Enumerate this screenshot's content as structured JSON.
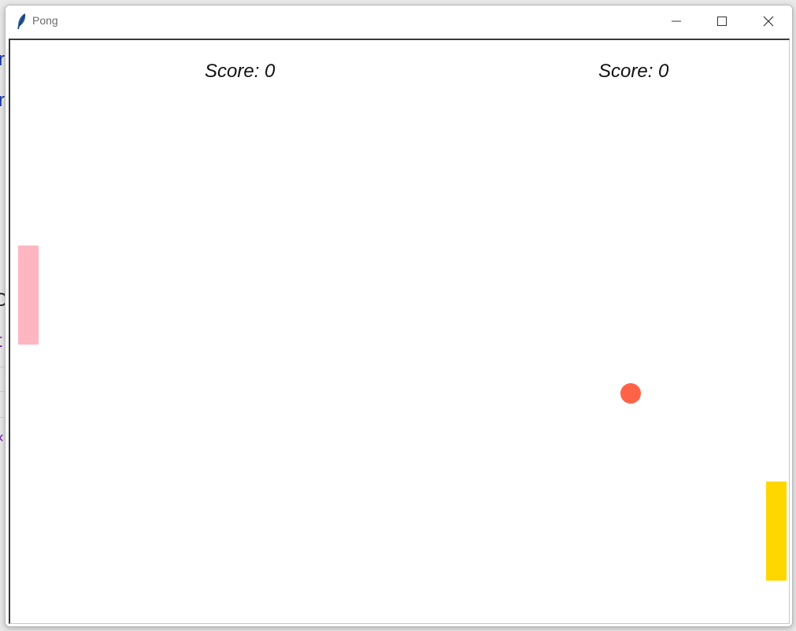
{
  "window": {
    "title": "Pong",
    "controls": {
      "minimize_icon": "minimize-icon",
      "maximize_icon": "maximize-icon",
      "close_icon": "close-icon"
    },
    "app_icon": "feather-icon"
  },
  "game": {
    "left_score_text": "Score: 0",
    "right_score_text": "Score: 0",
    "left_score": 0,
    "right_score": 0,
    "colors": {
      "background": "#ffffff",
      "left_paddle": "#ffb6c1",
      "right_paddle": "#ffd700",
      "ball": "#ff6347"
    }
  },
  "background_app": {
    "colors": {
      "link": "#1a3aa6",
      "visited": "#6a1b9a"
    }
  }
}
